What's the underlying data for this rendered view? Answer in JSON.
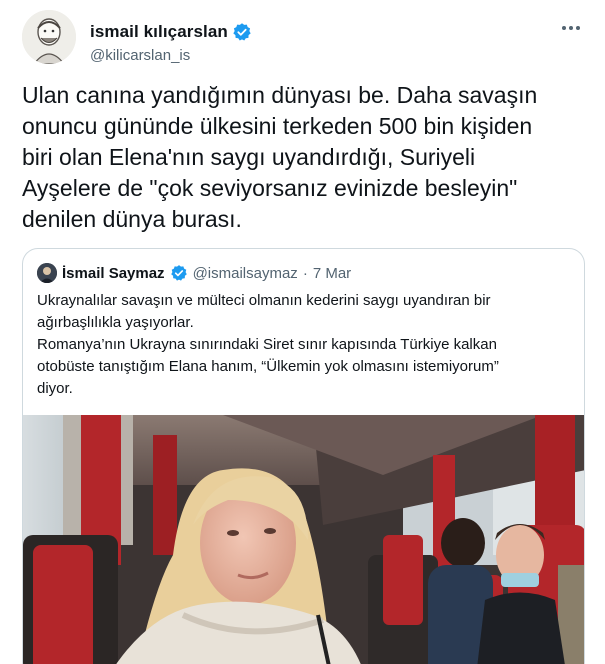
{
  "author": {
    "name": "ismail kılıçarslan",
    "handle": "@kilicarslan_is"
  },
  "tweet": {
    "text": "Ulan canına yandığımın dünyası be. Daha savaşın\nonuncu gününde ülkesini terkeden 500 bin kişiden\nbiri olan Elena'nın saygı uyandırdığı, Suriyeli\nAyşelere de \"çok seviyorsanız evinizde besleyin\"\ndenilen dünya burası."
  },
  "quoted": {
    "name": "İsmail Saymaz",
    "handle": "@ismailsaymaz",
    "separator": "·",
    "date": "7 Mar",
    "text": "Ukraynalılar savaşın ve mülteci olmanın kederini saygı uyandıran bir\nağırbaşlılıkla yaşıyorlar.\nRomanya’nın Ukrayna sınırındaki Siret sınır kapısında Türkiye kalkan\notobüste tanıştığım Elana hanım, “Ülkemin yok olmasını istemiyorum”\ndiyor."
  },
  "icons": {
    "verified": "verified-badge-icon",
    "more": "more-options-icon"
  },
  "colors": {
    "verified_blue": "#1d9bf0",
    "text_primary": "#0f1419",
    "text_secondary": "#536471",
    "border": "#cfd9de",
    "bus_seat_red": "#b3262a"
  }
}
